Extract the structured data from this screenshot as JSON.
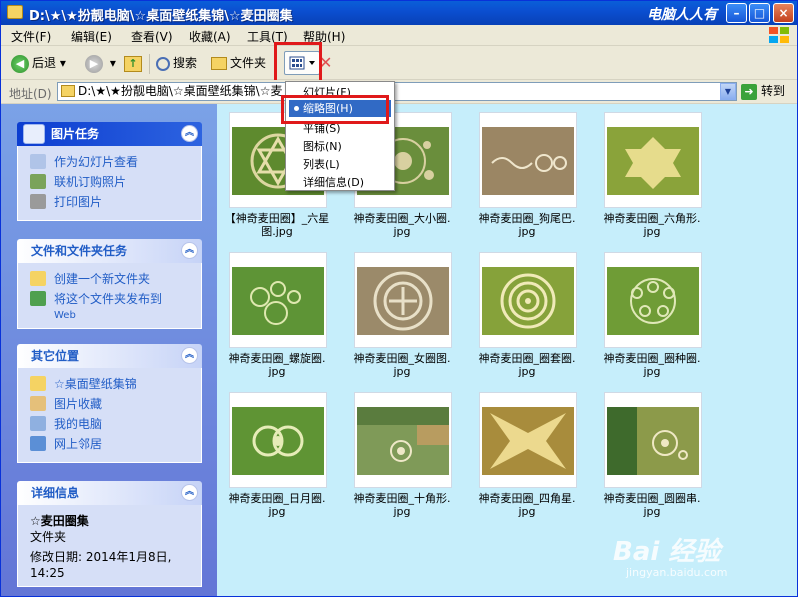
{
  "window": {
    "title": "D:\\★\\★扮靓电脑\\☆桌面壁纸集锦\\☆麦田圈集",
    "brand_text": "电脑人人有",
    "min_label": "–",
    "max_label": "□",
    "close_label": "×"
  },
  "menu": [
    "文件(F)",
    "编辑(E)",
    "查看(V)",
    "收藏(A)",
    "工具(T)",
    "帮助(H)"
  ],
  "toolbar": {
    "back": "后退",
    "search": "搜索",
    "folders": "文件夹"
  },
  "address": {
    "label": "地址(D)",
    "value": "D:\\★\\★扮靓电脑\\☆桌面壁纸集锦\\☆麦",
    "go": "转到"
  },
  "view_menu": {
    "items": [
      "幻灯片(F)",
      "缩略图(H)",
      "平铺(S)",
      "图标(N)",
      "列表(L)",
      "详细信息(D)"
    ],
    "selected": "缩略图(H)"
  },
  "left_pane": {
    "picture_tasks": {
      "title": "图片任务",
      "links": [
        "作为幻灯片查看",
        "联机订购照片",
        "打印图片"
      ]
    },
    "file_tasks": {
      "title": "文件和文件夹任务",
      "links": [
        "创建一个新文件夹",
        "将这个文件夹发布到",
        "Web"
      ]
    },
    "other_places": {
      "title": "其它位置",
      "links": [
        "☆桌面壁纸集锦",
        "图片收藏",
        "我的电脑",
        "网上邻居"
      ]
    },
    "details": {
      "title": "详细信息",
      "name": "☆麦田圈集",
      "type": "文件夹",
      "modified": "修改日期: 2014年1月8日,",
      "time": "14:25"
    }
  },
  "files": [
    {
      "line1": "【神奇麦田圈】_六星",
      "line2": "图.jpg"
    },
    {
      "line1": "神奇麦田圈_大小圈.",
      "line2": "jpg"
    },
    {
      "line1": "神奇麦田圈_狗尾巴.",
      "line2": "jpg"
    },
    {
      "line1": "神奇麦田圈_六角形.",
      "line2": "jpg"
    },
    {
      "line1": "神奇麦田圈_螺旋圈.",
      "line2": "jpg"
    },
    {
      "line1": "神奇麦田圈_女圈图.",
      "line2": "jpg"
    },
    {
      "line1": "神奇麦田圈_圈套圈.",
      "line2": "jpg"
    },
    {
      "line1": "神奇麦田圈_圈种圈.",
      "line2": "jpg"
    },
    {
      "line1": "神奇麦田圈_日月圈.",
      "line2": "jpg"
    },
    {
      "line1": "神奇麦田圈_十角形.",
      "line2": "jpg"
    },
    {
      "line1": "神奇麦田圈_四角星.",
      "line2": "jpg"
    },
    {
      "line1": "神奇麦田圈_圆圈串.",
      "line2": "jpg"
    }
  ],
  "watermark": {
    "main": "Bai 经验",
    "sub": "jingyan.baidu.com"
  },
  "colors": {
    "titlebar": "#0b4fd1",
    "left_pane": "#6375d6",
    "content_bg": "#c6eefb",
    "highlight": "#e0191a",
    "selection": "#316ac5"
  }
}
